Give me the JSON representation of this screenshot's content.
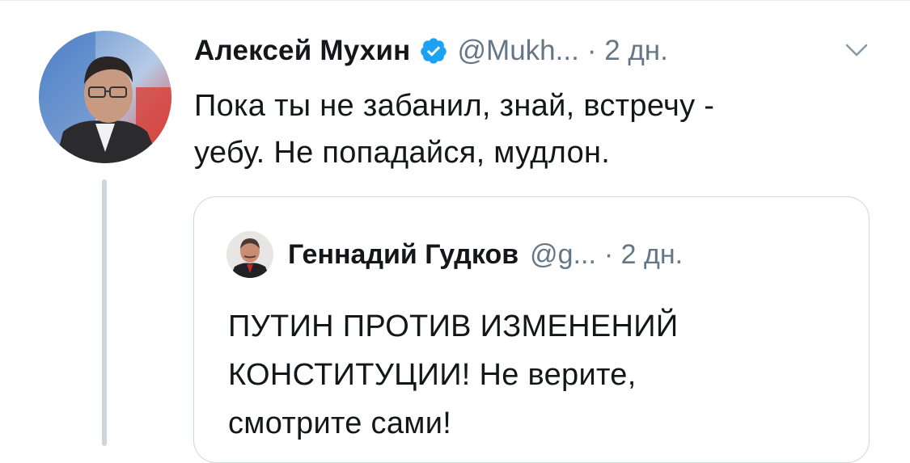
{
  "tweet": {
    "author_name": "Алексей Мухин",
    "handle": "@Mukh...",
    "time": "· 2 дн.",
    "text_lines": [
      "Пока ты не забанил, знай,  встречу -",
      "уебу. Не попадайся, мудлон."
    ],
    "verified_icon": "verified-badge-icon",
    "menu_icon": "chevron-down-icon"
  },
  "quoted_tweet": {
    "author_name": "Геннадий Гудков",
    "handle": "@g...",
    "time": "· 2 дн.",
    "text_lines": [
      "ПУТИН ПРОТИВ ИЗМЕНЕНИЙ",
      "КОНСТИТУЦИИ! Не верите,",
      "смотрите сами!"
    ]
  },
  "colors": {
    "text": "#14171a",
    "secondary": "#657786",
    "verified": "#1da1f2",
    "border": "#ccd6dd"
  }
}
